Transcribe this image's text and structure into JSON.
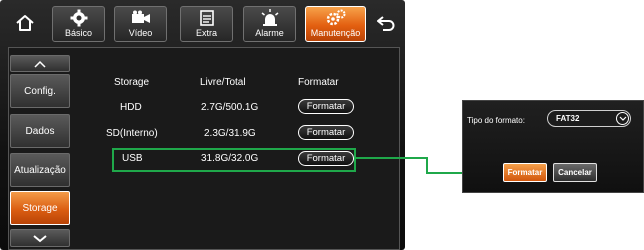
{
  "tabs": [
    {
      "label": "Básico",
      "icon": "gear-icon"
    },
    {
      "label": "Vídeo",
      "icon": "camera-icon"
    },
    {
      "label": "Extra",
      "icon": "document-icon"
    },
    {
      "label": "Alarme",
      "icon": "alarm-light-icon"
    },
    {
      "label": "Manutenção",
      "icon": "maintenance-gears-icon",
      "active": true
    }
  ],
  "sidebar": {
    "items": [
      {
        "label": "Config."
      },
      {
        "label": "Dados"
      },
      {
        "label": "Atualização"
      },
      {
        "label": "Storage",
        "active": true
      }
    ]
  },
  "table": {
    "headers": {
      "storage": "Storage",
      "free_total": "Livre/Total",
      "format": "Formatar"
    },
    "rows": [
      {
        "storage": "HDD",
        "free_total": "2.7G/500.1G",
        "action": "Formatar"
      },
      {
        "storage": "SD(Interno)",
        "free_total": "2.3G/31.9G",
        "action": "Formatar"
      },
      {
        "storage": "USB",
        "free_total": "31.8G/32.0G",
        "action": "Formatar",
        "highlighted": true
      }
    ]
  },
  "dialog": {
    "format_type_label": "Tipo do formato:",
    "format_type_value": "FAT32",
    "confirm_label": "Formatar",
    "cancel_label": "Cancelar"
  },
  "colors": {
    "accent": "#e35f10",
    "highlight": "#1fa84a"
  }
}
